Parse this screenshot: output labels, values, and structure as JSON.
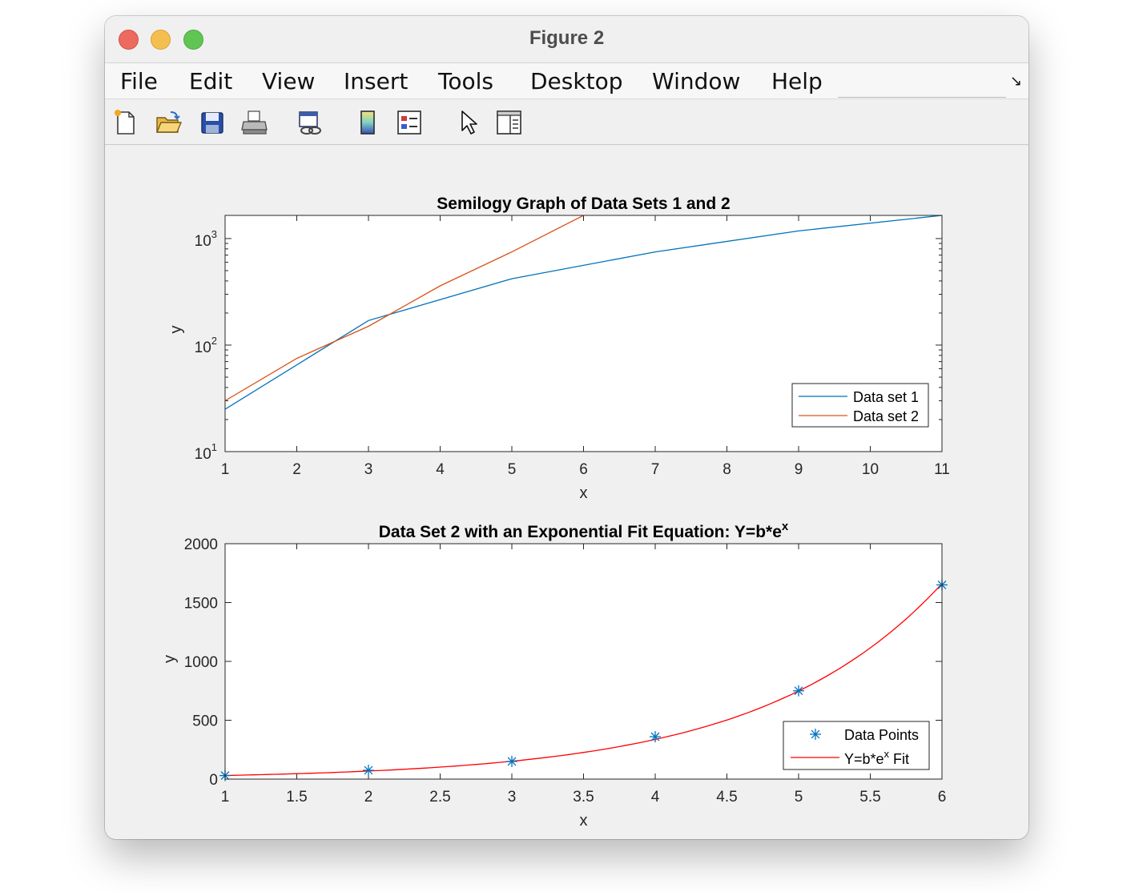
{
  "window": {
    "title": "Figure 2"
  },
  "menu": [
    "File",
    "Edit",
    "View",
    "Insert",
    "Tools",
    "Desktop",
    "Window",
    "Help"
  ],
  "toolbar": {
    "buttons": [
      {
        "name": "new-figure-icon"
      },
      {
        "name": "open-file-icon"
      },
      {
        "name": "save-icon"
      },
      {
        "name": "print-icon"
      },
      {
        "name": "link-plot-icon"
      },
      {
        "name": "colorbar-icon"
      },
      {
        "name": "legend-icon"
      },
      {
        "name": "edit-plot-arrow-icon"
      },
      {
        "name": "property-inspector-icon"
      }
    ]
  },
  "chart_data": [
    {
      "type": "line",
      "title": "Semilogy Graph of Data Sets 1 and 2",
      "xlabel": "x",
      "ylabel": "y",
      "yscale": "log",
      "xlim": [
        1,
        11
      ],
      "ylim": [
        10,
        1650
      ],
      "xticks": [
        "1",
        "2",
        "3",
        "4",
        "5",
        "6",
        "7",
        "8",
        "9",
        "10",
        "11"
      ],
      "yticks": [
        {
          "value": 10,
          "base": "10",
          "exp": "1"
        },
        {
          "value": 100,
          "base": "10",
          "exp": "2"
        },
        {
          "value": 1000,
          "base": "10",
          "exp": "3"
        }
      ],
      "legend_position": "bottom-right",
      "series": [
        {
          "name": "Data set 1",
          "color": "#0072bd",
          "x": [
            1,
            3,
            5,
            7,
            9,
            11
          ],
          "values": [
            25,
            170,
            420,
            750,
            1180,
            1650
          ]
        },
        {
          "name": "Data set 2",
          "color": "#d95319",
          "x": [
            1,
            2,
            3,
            4,
            5,
            6
          ],
          "values": [
            30,
            75,
            150,
            360,
            750,
            1650
          ]
        }
      ]
    },
    {
      "type": "scatter",
      "title": {
        "prefix": "Data Set 2 with an Exponential Fit Equation: Y=b*e",
        "sup": "x"
      },
      "xlabel": "x",
      "ylabel": "y",
      "xlim": [
        1,
        6
      ],
      "ylim": [
        0,
        2000
      ],
      "xticks": [
        "1",
        "1.5",
        "2",
        "2.5",
        "3",
        "3.5",
        "4",
        "4.5",
        "5",
        "5.5",
        "6"
      ],
      "yticks": [
        "0",
        "500",
        "1000",
        "1500",
        "2000"
      ],
      "legend_position": "bottom-right",
      "series": [
        {
          "name": "Data Points",
          "marker": "*",
          "color": "#0072bd",
          "x": [
            1,
            2,
            3,
            4,
            5,
            6
          ],
          "values": [
            30,
            75,
            150,
            360,
            750,
            1650
          ]
        },
        {
          "name": {
            "prefix": "Y=b*e",
            "sup": "x",
            "suffix": " Fit"
          },
          "type": "line",
          "color": "#ff0000",
          "fit": {
            "b": 13.9,
            "k": 0.7972
          }
        }
      ]
    }
  ]
}
